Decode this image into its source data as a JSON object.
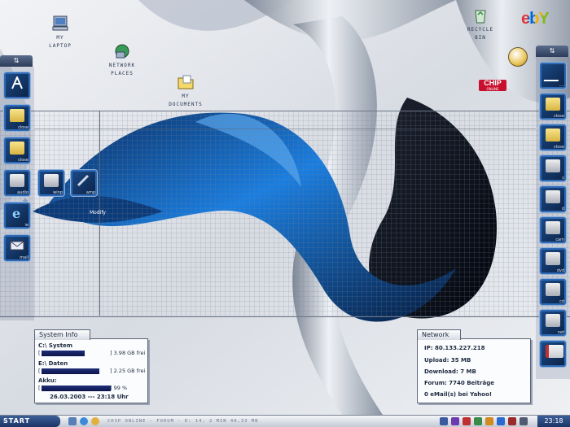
{
  "desktop": {
    "icons": [
      {
        "label": "MY\nLAPTOP"
      },
      {
        "label": "NETWORK\nPLACES"
      },
      {
        "label": "MY\nDOCUMENTS"
      },
      {
        "label": "RECYCLE\nBIN"
      }
    ],
    "brands": {
      "ebay": "ebY",
      "chip": "CHIP",
      "chip_sub": "ONLINE"
    }
  },
  "left_dock": {
    "tiles": [
      {
        "label": ""
      },
      {
        "label": "close"
      },
      {
        "label": "close"
      },
      {
        "label": "audio"
      },
      {
        "label": "ie"
      },
      {
        "label": "mail"
      }
    ],
    "popout": [
      {
        "label": "winp"
      },
      {
        "label": "amp"
      }
    ],
    "floating_label": "Modify"
  },
  "right_dock": {
    "tiles": [
      {
        "label": "...."
      },
      {
        "label": "close"
      },
      {
        "label": "close"
      },
      {
        "label": "c"
      },
      {
        "label": "d"
      },
      {
        "label": "cam"
      },
      {
        "label": "dvd"
      },
      {
        "label": "cd"
      },
      {
        "label": "net"
      },
      {
        "label": ""
      }
    ]
  },
  "system_info": {
    "title": "System Info",
    "drives": [
      {
        "name": "C:\\ System",
        "fill_fraction": 0.62,
        "text": "] 3.98 GB frei"
      },
      {
        "name": "E:\\ Daten",
        "fill_fraction": 0.82,
        "text": "] 2.25 GB frei"
      },
      {
        "name": "Akku:",
        "fill_fraction": 0.99,
        "text": "] 99 %"
      }
    ],
    "bracket_open": "[",
    "datetime": "26.03.2003 --- 23:18 Uhr"
  },
  "network": {
    "title": "Network",
    "lines": [
      "IP: 80.133.227.218",
      "Upload: 35 MB",
      "Download: 7 MB",
      "Forum: 7740 Beiträge",
      "0 eMail(s) bei Yahoo!"
    ]
  },
  "taskbar": {
    "start_label": "START",
    "status_text": "CHIP ONLINE - FORUM - D: 14, 2 MIN 40,33 MB",
    "clock": "23:18"
  },
  "colors": {
    "accent": "#1b3566",
    "wallpaper_blue": "#1467c8",
    "panel_bar": "#0c144a"
  }
}
